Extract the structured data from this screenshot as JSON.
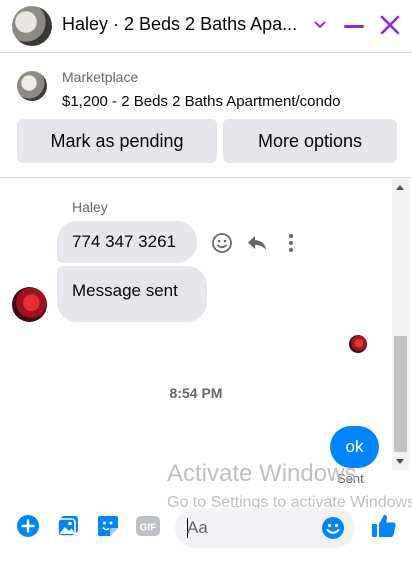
{
  "header": {
    "title": "Haley · 2 Beds 2 Baths Apa...",
    "icons": [
      "chevron-down-icon",
      "minimize-icon",
      "close-icon"
    ]
  },
  "marketplace": {
    "label": "Marketplace",
    "listing": "$1,200 - 2 Beds 2 Baths Apartment/condo",
    "buttons": {
      "pending": "Mark as pending",
      "more": "More options"
    }
  },
  "conversation": {
    "sender_name": "Haley",
    "messages": [
      {
        "from": "Haley",
        "text": "774 347 3261"
      },
      {
        "from": "Haley",
        "text": "Message sent"
      },
      {
        "from": "me",
        "text": "ok"
      }
    ],
    "timestamp": "8:54 PM",
    "status": "Sent"
  },
  "watermark": {
    "line1": "Activate Windows",
    "line2": "Go to Settings to activate Windows."
  },
  "composer": {
    "placeholder": "Aa",
    "icons": [
      "add-icon",
      "photo-icon",
      "sticker-icon",
      "gif-icon",
      "emoji-icon",
      "thumbs-up-icon"
    ]
  },
  "colors": {
    "accent": "#8a2be2",
    "messenger_blue": "#0084ff",
    "bubble_gray": "#e4e6eb"
  }
}
